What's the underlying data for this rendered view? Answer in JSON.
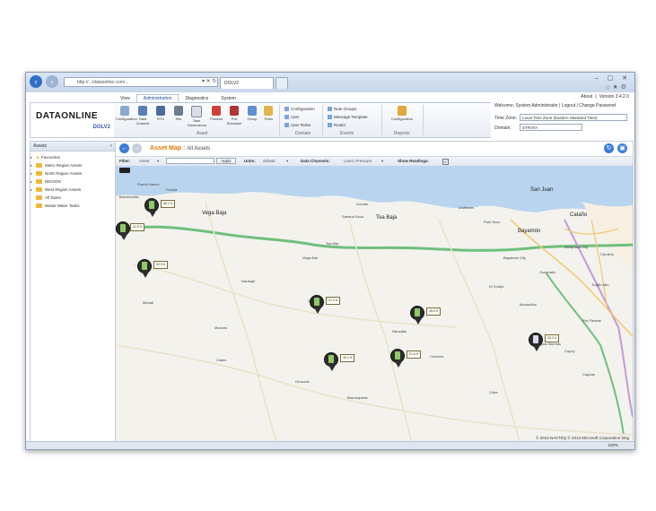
{
  "browser": {
    "address": "http://.../dataonline.com/...",
    "active_tab": "DOLV2",
    "window_controls": "–  ▢  ✕"
  },
  "app": {
    "menu_tabs": [
      "View",
      "Administration",
      "Diagnostics",
      "System"
    ],
    "active_menu": "Administration",
    "top_links": [
      "About",
      "|",
      "Version 3.4.2.0"
    ],
    "logo_text": "DATAONLINE",
    "logo_sub": "DOLV2",
    "ribbon": {
      "asset_buttons": [
        "Configuration",
        "Data Channel",
        "RTU",
        "Site",
        "Tank Dimensions",
        "Product",
        "Poll Schedule",
        "Group",
        "Trees"
      ],
      "group_asset": "Asset",
      "domain_items": [
        "Configuration",
        "User",
        "User Roles"
      ],
      "group_domain": "Domain",
      "events_items": [
        "Rule Groups",
        "Message Template",
        "Roster"
      ],
      "group_events": "Events",
      "reports_button": "Configuration",
      "group_reports": "Reports"
    },
    "welcome": "Welcome, System Administrator  |  Logout  |  Change Password",
    "time_zone_label": "Time Zone:",
    "time_zone_value": "Local Time Zone (Eastern Standard Time)",
    "domain_label": "Domain:",
    "domain_value": "STRATA"
  },
  "sidebar": {
    "title": "Assets",
    "collapse": "‹",
    "items": [
      {
        "label": "Favourites",
        "type": "star"
      },
      {
        "label": "Metro Region Assets",
        "type": "folder"
      },
      {
        "label": "North Region Assets",
        "type": "folder"
      },
      {
        "label": "REGION",
        "type": "folder"
      },
      {
        "label": "West Region Assets",
        "type": "folder"
      },
      {
        "label": "All Tanks",
        "type": "folder"
      },
      {
        "label": "Waste Water Tanks",
        "type": "folder"
      }
    ]
  },
  "main": {
    "title": "Asset Map :",
    "subtitle": "All Assets",
    "filter_label": "Filter:",
    "filter_value": "Asset",
    "apply_label": "Apply",
    "units_label": "Units:",
    "units_value": "default",
    "channels_label": "Data Channels:",
    "channels_value": "Level, Pressure",
    "readings_label": "Show Readings:",
    "readings_checked": "✔"
  },
  "map": {
    "places_big": [
      "Vega Baja",
      "Toa Baja",
      "San Juan",
      "Cataño",
      "Bayamón",
      "Barceloneta"
    ],
    "places": [
      "Puerto Nuevo",
      "Manatí",
      "Vega Alta",
      "Dorado",
      "Toa Alta",
      "Corozal",
      "Naranjito",
      "Morovis",
      "Orocovis",
      "Ciales",
      "Guaynabo",
      "Trujillo Alto",
      "Caguas",
      "Cidra",
      "Comerío",
      "Aguas Buenas",
      "Barranquitas",
      "Florida",
      "Levittown",
      "Sabana Seca",
      "Guaynabo City",
      "Bayamón City",
      "Carolina",
      "Río Piedras",
      "Cupey",
      "Monacillos",
      "Naranjal",
      "Palo Seco",
      "El Cortijo"
    ],
    "readings": [
      "58.2 ft",
      "31.5 ft",
      "52.9 ft",
      "37.2 ft",
      "45.6 ft",
      "40.1 ft",
      "51.6 ft",
      "28.3 ft"
    ],
    "copyright": "© 2013 NAVTEQ  © 2013 Microsoft Corporation  bing"
  },
  "status": {
    "zoom": "100%"
  }
}
